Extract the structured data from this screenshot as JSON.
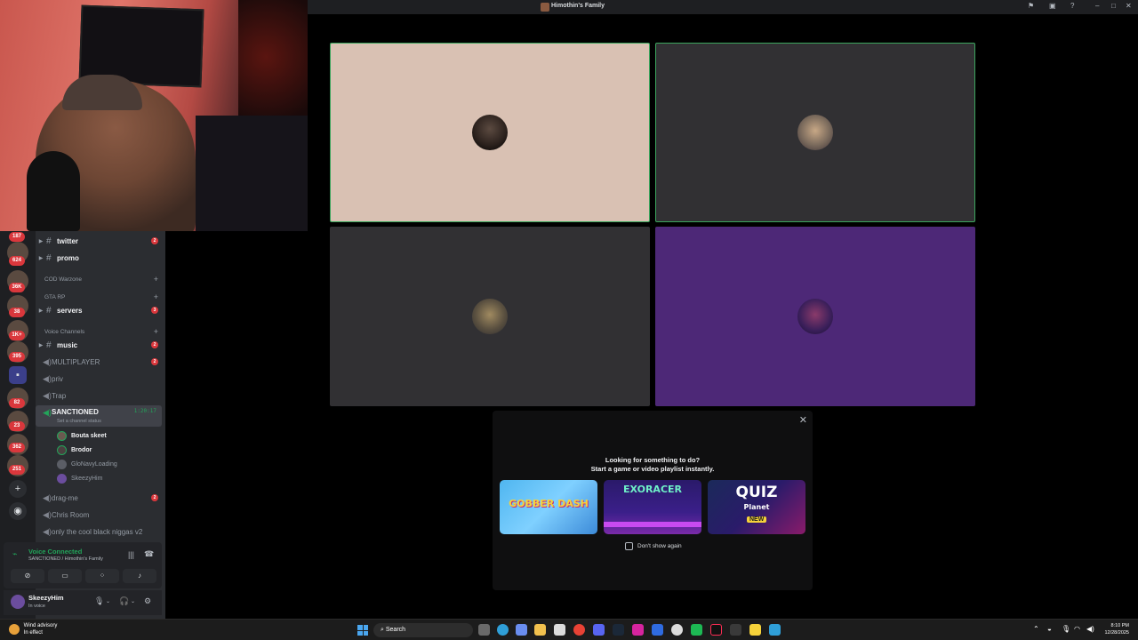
{
  "window": {
    "title": "Himothin's Family"
  },
  "rail": {
    "badges": [
      "187",
      "624",
      "36K",
      "38",
      "1K+",
      "395",
      "82",
      "23",
      "362",
      "251"
    ]
  },
  "channels": {
    "text": [
      {
        "name": "twitter",
        "badge": "2"
      },
      {
        "name": "promo"
      }
    ],
    "categories": [
      {
        "label": "COD Warzone"
      },
      {
        "label": "GTA RP"
      }
    ],
    "servers": {
      "name": "servers",
      "badge": "3"
    },
    "voice_category": "Voice Channels",
    "voice": [
      {
        "name": "music",
        "badge": "2"
      },
      {
        "name": "MULTIPLAYER",
        "badge": "2"
      },
      {
        "name": "priv"
      },
      {
        "name": "Trap"
      }
    ],
    "active_voice": {
      "name": "SANCTIONED",
      "timer": "1:20:17",
      "status": "Set a channel status"
    },
    "members": [
      "Bouta skeet",
      "Brodor",
      "GloNavyLoading",
      "SkeezyHim"
    ],
    "voice_after": [
      {
        "name": "drag-me",
        "badge": "2"
      },
      {
        "name": "Chris Room"
      },
      {
        "name": "only the cool black niggas v2"
      }
    ]
  },
  "voice_panel": {
    "title": "Voice Connected",
    "subtitle": "SANCTIONED / Himothin's Family"
  },
  "user": {
    "name": "SkeezyHim",
    "status": "In voice"
  },
  "activity": {
    "line1": "Looking for something to do?",
    "line2": "Start a game or video playlist instantly.",
    "games": [
      {
        "title": "GOBBER DASH"
      },
      {
        "title": "EXORACER"
      },
      {
        "title": "QUIZ",
        "subtitle": "Planet",
        "tag": "NEW"
      }
    ],
    "dont_show": "Don't show again"
  },
  "taskbar": {
    "weather_title": "Wind advisory",
    "weather_sub": "In effect",
    "search": "Search",
    "time": "8:10 PM",
    "date": "12/28/2025"
  },
  "colors": {
    "tile1": "#d9c1b3",
    "tile2": "#313033",
    "tile3": "#313033",
    "tile4": "#4d2877",
    "speaking": "#3ba55d"
  }
}
